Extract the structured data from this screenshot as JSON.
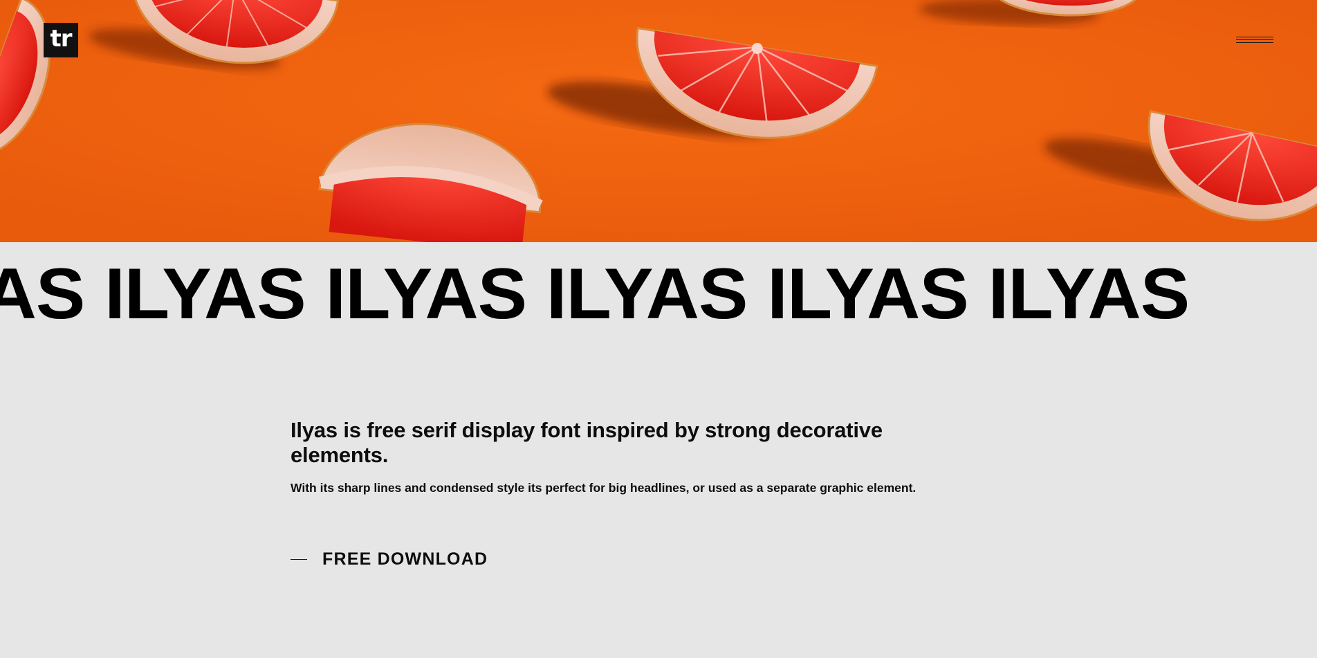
{
  "header": {
    "logo_text": "tr",
    "menu_icon": "hamburger-menu-icon"
  },
  "hero": {
    "image": "grapefruit-slices-on-orange-background",
    "background_color": "#f0620f"
  },
  "marquee": {
    "text": "YAS ILYAS ILYAS ILYAS ILYAS ILYAS"
  },
  "main": {
    "headline": "Ilyas is free serif display font inspired by strong decorative elements.",
    "description": "With its sharp lines and condensed style its perfect for big headlines, or used as a separate graphic element.",
    "download_label": "FREE DOWNLOAD"
  }
}
